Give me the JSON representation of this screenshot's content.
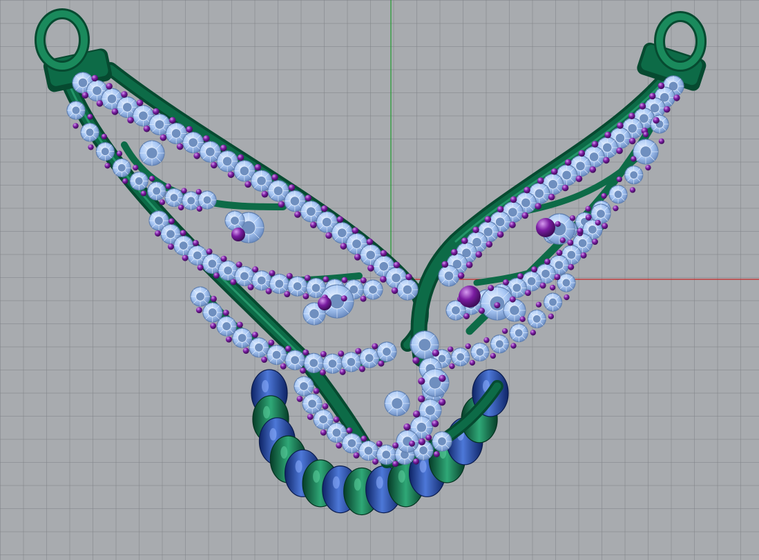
{
  "viewport": {
    "type": "3d-perspective",
    "grid": true,
    "axes": {
      "x": "red",
      "y": "green"
    }
  },
  "model": {
    "subject": "wing-pendant",
    "icon": "wing-pendant-icon",
    "colors": {
      "background": "#a8abaf",
      "grid_line": "#8c9095",
      "x_axis": "#c62626",
      "y_axis": "#1f9b2e",
      "metal": "#0d6b47",
      "metal_dark": "#064a30",
      "metal_light": "#2fa877",
      "stone": "#a9c8f5",
      "stone_dark": "#5f7fb0",
      "prong": "#7a1ca1",
      "prong_light": "#b35ad8",
      "bead": "#1a3e96",
      "bead_light": "#4d78d8"
    }
  }
}
